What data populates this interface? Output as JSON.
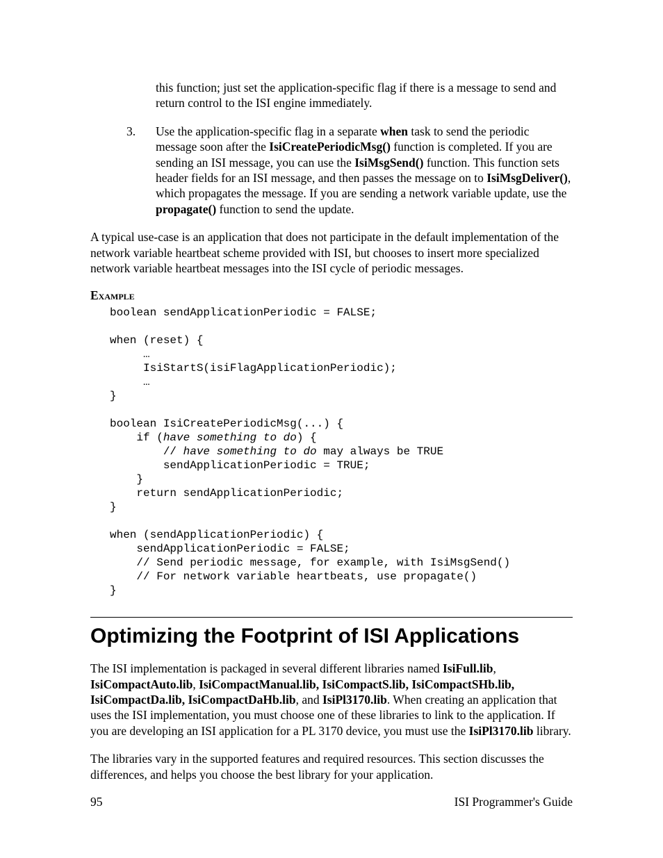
{
  "top": {
    "continuation": "this function; just set the application-specific flag if there is a message to send and return control to the ISI engine immediately."
  },
  "list3": {
    "num": "3.",
    "p1a": "Use the application-specific flag in a separate ",
    "when": "when",
    "p1b": " task to send the periodic message soon after the ",
    "fn1": "IsiCreatePeriodicMsg()",
    "p1c": " function is completed.  If you are sending an ISI message, you can use the ",
    "fn2": "IsiMsgSend()",
    "p1d": " function.  This function sets header fields for an ISI message, and then passes the message on to ",
    "fn3": "IsiMsgDeliver()",
    "p1e": ", which propagates the message.  If you are sending a network variable update, use the ",
    "fn4": "propagate()",
    "p1f": " function to send the update."
  },
  "usecase": "A typical use-case is an application that does not participate in the default implementation of the network variable heartbeat scheme provided with ISI, but chooses to insert more specialized network variable heartbeat messages into the ISI cycle of periodic messages.",
  "example_label": "Example",
  "code": {
    "l1": "boolean sendApplicationPeriodic = FALSE;",
    "l2": "",
    "l3": "when (reset) {",
    "l4": "     …",
    "l5": "     IsiStartS(isiFlagApplicationPeriodic);",
    "l6": "     …",
    "l7": "}",
    "l8": "",
    "l9": "boolean IsiCreatePeriodicMsg(...) {",
    "l10a": "    if (",
    "l10b": "have something to do",
    "l10c": ") {",
    "l11a": "        // ",
    "l11b": "have something to do",
    "l11c": " may always be TRUE",
    "l12": "        sendApplicationPeriodic = TRUE;",
    "l13": "    }",
    "l14": "    return sendApplicationPeriodic;",
    "l15": "}",
    "l16": "",
    "l17": "when (sendApplicationPeriodic) {",
    "l18": "    sendApplicationPeriodic = FALSE;",
    "l19": "    // Send periodic message, for example, with IsiMsgSend()",
    "l20": "    // For network variable heartbeats, use propagate()",
    "l21": "}"
  },
  "h1": "Optimizing the Footprint of ISI Applications",
  "opt": {
    "p1a": "The ISI implementation is packaged in several different libraries named ",
    "libs1": "IsiFull.lib",
    "c1": ", ",
    "libs2": "IsiCompactAuto.lib",
    "c2": ", ",
    "libs3": "IsiCompactManual.lib, IsiCompactS.lib, IsiCompactSHb.lib, IsiCompactDa.lib, IsiCompactDaHb.lib",
    "c3": ", and ",
    "libs4": "IsiPl3170.lib",
    "p1b": ".  When creating an application that uses the ISI implementation, you must choose one of these libraries to link to the application.  If you are developing an ISI application for a PL 3170 device, you must use the ",
    "libs5": "IsiPl3170.lib",
    "p1c": " library.",
    "p2": "The libraries vary in the supported features and required resources.  This section discusses the differences, and helps you choose the best library for your application."
  },
  "footer": {
    "page": "95",
    "title": "ISI Programmer's Guide"
  }
}
